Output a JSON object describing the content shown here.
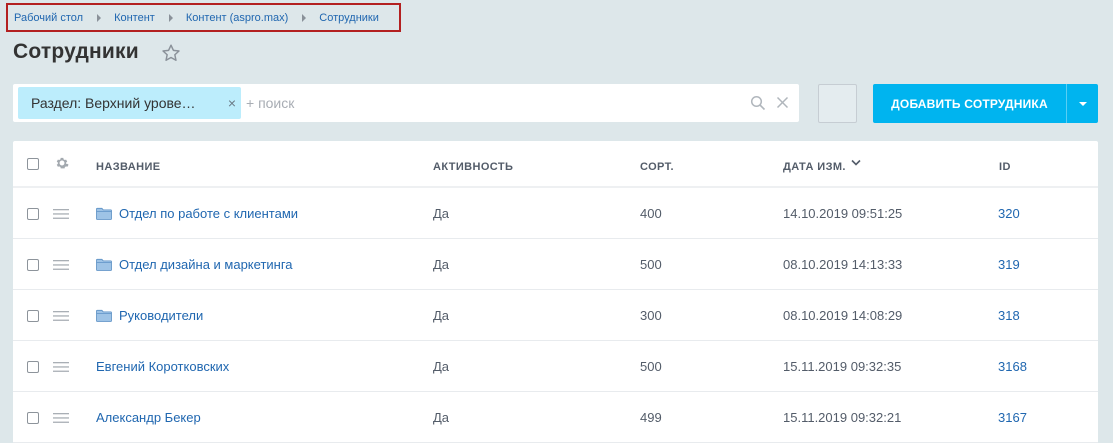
{
  "breadcrumb": [
    "Рабочий стол",
    "Контент",
    "Контент (aspro.max)",
    "Сотрудники"
  ],
  "page": {
    "title": "Сотрудники"
  },
  "filter": {
    "chip_label": "Раздел: Верхний урове…",
    "chip_close": "×",
    "search_placeholder": "+ поиск"
  },
  "toolbar": {
    "add_label": "ДОБАВИТЬ СОТРУДНИКА"
  },
  "columns": {
    "name": "НАЗВАНИЕ",
    "active": "АКТИВНОСТЬ",
    "sort": "СОРТ.",
    "date": "ДАТА ИЗМ.",
    "id": "ID"
  },
  "rows": [
    {
      "name": "Отдел по работе с клиентами",
      "active": "Да",
      "sort": "400",
      "date": "14.10.2019 09:51:25",
      "id": "320",
      "folder": true
    },
    {
      "name": "Отдел дизайна и маркетинга",
      "active": "Да",
      "sort": "500",
      "date": "08.10.2019 14:13:33",
      "id": "319",
      "folder": true
    },
    {
      "name": "Руководители",
      "active": "Да",
      "sort": "300",
      "date": "08.10.2019 14:08:29",
      "id": "318",
      "folder": true
    },
    {
      "name": "Евгений Коротковских",
      "active": "Да",
      "sort": "500",
      "date": "15.11.2019 09:32:35",
      "id": "3168",
      "folder": false
    },
    {
      "name": "Александр Бекер",
      "active": "Да",
      "sort": "499",
      "date": "15.11.2019 09:32:21",
      "id": "3167",
      "folder": false
    }
  ],
  "colors": {
    "accent": "#00b4ef",
    "link": "#2067b0",
    "chip": "#bcedfc",
    "highlight": "#b32020"
  }
}
